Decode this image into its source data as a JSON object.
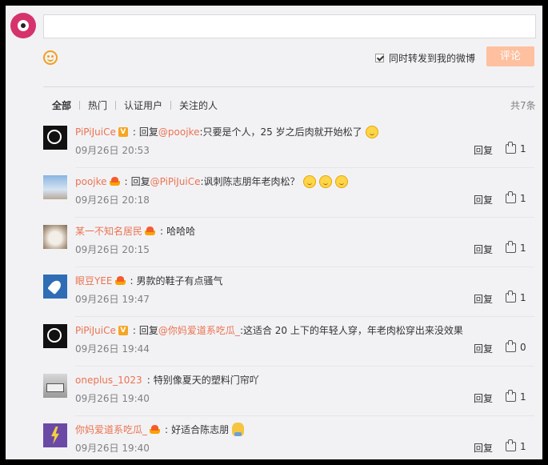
{
  "composer": {
    "placeholder": "",
    "repost_label": "同时转发到我的微博",
    "repost_checked": true,
    "submit_label": "评论",
    "emoji_icon": "smile-icon"
  },
  "tabs": [
    "全部",
    "热门",
    "认证用户",
    "关注的人"
  ],
  "active_tab": 0,
  "total_label": "共7条",
  "colors": {
    "accent": "#eb7350",
    "submit_bg": "#ffc09f"
  },
  "comments": [
    {
      "user": "PiPiJuiCe",
      "badge": "V",
      "reply_prefix": "回复",
      "mention": "@poojke",
      "text": ":只要是个人，25 岁之后肉就开始松了",
      "time": "09月26日 20:53",
      "reply_label": "回复",
      "likes": "1"
    },
    {
      "user": "poojke",
      "badge": "crown",
      "reply_prefix": "回复",
      "mention": "@PiPiJuiCe",
      "text": ":讽刺陈志朋年老肉松？",
      "time": "09月26日 20:18",
      "reply_label": "回复",
      "likes": "1"
    },
    {
      "user": "某一不知名居民",
      "badge": "crown",
      "reply_prefix": "",
      "mention": "",
      "text": "哈哈哈",
      "time": "09月26日 20:15",
      "reply_label": "回复",
      "likes": "1"
    },
    {
      "user": "眼豆YEE",
      "badge": "crown",
      "reply_prefix": "",
      "mention": "",
      "text": "男款的鞋子有点骚气",
      "time": "09月26日 19:47",
      "reply_label": "回复",
      "likes": "1"
    },
    {
      "user": "PiPiJuiCe",
      "badge": "V",
      "reply_prefix": "回复",
      "mention": "@你妈爱道系吃瓜_",
      "text": ":这适合 20 上下的年轻人穿，年老肉松穿出来没效果",
      "time": "09月26日 19:44",
      "reply_label": "回复",
      "likes": "0"
    },
    {
      "user": "oneplus_1023",
      "badge": "",
      "reply_prefix": "",
      "mention": "",
      "text": "特别像夏天的塑料门帘吖",
      "time": "09月26日 19:40",
      "reply_label": "回复",
      "likes": "1"
    },
    {
      "user": "你妈爱道系吃瓜_",
      "badge": "crown",
      "reply_prefix": "",
      "mention": "",
      "text": "好适合陈志朋",
      "time": "09月26日 19:40",
      "reply_label": "回复",
      "likes": "1"
    }
  ]
}
